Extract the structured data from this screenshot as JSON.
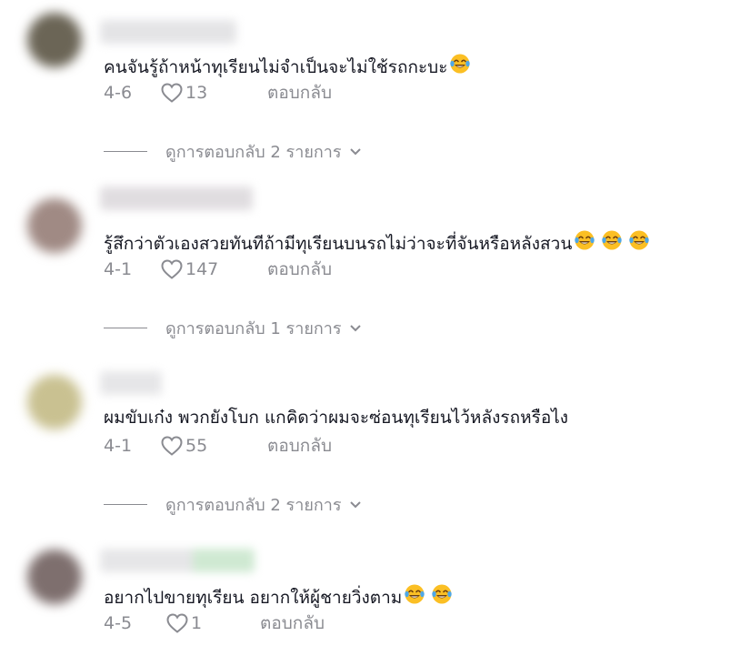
{
  "colors": {
    "text": "#161823",
    "muted": "#8a8b91",
    "emoji_face": "#fbbf24",
    "emoji_tear": "#4ea7e8"
  },
  "comments": [
    {
      "text": "คนจันรู้ถ้าหน้าทุเรียนไม่จำเป็นจะไม่ใช้รถกะบะ",
      "emoji_count": 1,
      "date": "4-6",
      "likes": "13",
      "reply_label": "ตอบกลับ",
      "view_replies": "ดูการตอบกลับ 2 รายการ",
      "avatar_color": "#6b6556",
      "username_color": "#e4e4e6"
    },
    {
      "text": "รู้สึกว่าตัวเองสวยทันทีถ้ามีทุเรียนบนรถไม่ว่าจะที่จันหรือหลังสวน",
      "emoji_count": 3,
      "date": "4-1",
      "likes": "147",
      "reply_label": "ตอบกลับ",
      "view_replies": "ดูการตอบกลับ 1 รายการ",
      "avatar_color": "#a08a84",
      "username_color": "#e0dde0"
    },
    {
      "text": "ผมขับเก๋ง พวกยังโบก แกคิดว่าผมจะซ่อนทุเรียนไว้หลังรถหรือไง",
      "emoji_count": 0,
      "date": "4-1",
      "likes": "55",
      "reply_label": "ตอบกลับ",
      "view_replies": "ดูการตอบกลับ 2 รายการ",
      "avatar_color": "#c9c191",
      "username_color": "#e6e6e8"
    },
    {
      "text": "อยากไปขายทุเรียน อยากให้ผู้ชายวิ่งตาม",
      "emoji_count": 2,
      "date": "4-5",
      "likes": "1",
      "reply_label": "ตอบกลับ",
      "view_replies": "",
      "avatar_color": "#7e6f6e",
      "username_color": "#dfe8df"
    }
  ]
}
